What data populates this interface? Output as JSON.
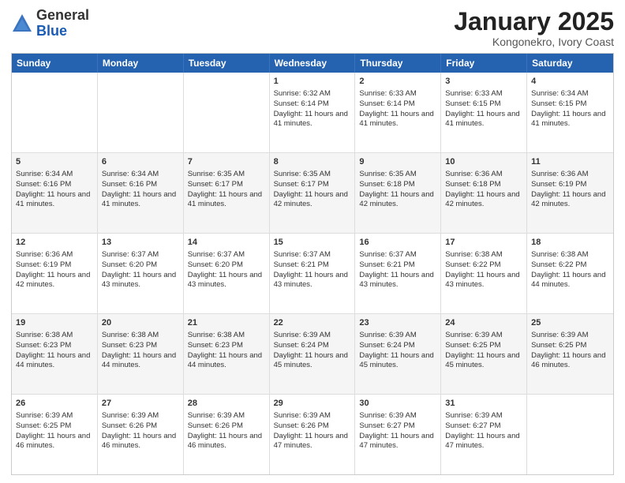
{
  "logo": {
    "general": "General",
    "blue": "Blue"
  },
  "title": "January 2025",
  "subtitle": "Kongonekro, Ivory Coast",
  "days": [
    "Sunday",
    "Monday",
    "Tuesday",
    "Wednesday",
    "Thursday",
    "Friday",
    "Saturday"
  ],
  "weeks": [
    [
      {
        "day": "",
        "info": "",
        "empty": true
      },
      {
        "day": "",
        "info": "",
        "empty": true
      },
      {
        "day": "",
        "info": "",
        "empty": true
      },
      {
        "day": "1",
        "info": "Sunrise: 6:32 AM\nSunset: 6:14 PM\nDaylight: 11 hours and 41 minutes.",
        "empty": false
      },
      {
        "day": "2",
        "info": "Sunrise: 6:33 AM\nSunset: 6:14 PM\nDaylight: 11 hours and 41 minutes.",
        "empty": false
      },
      {
        "day": "3",
        "info": "Sunrise: 6:33 AM\nSunset: 6:15 PM\nDaylight: 11 hours and 41 minutes.",
        "empty": false
      },
      {
        "day": "4",
        "info": "Sunrise: 6:34 AM\nSunset: 6:15 PM\nDaylight: 11 hours and 41 minutes.",
        "empty": false
      }
    ],
    [
      {
        "day": "5",
        "info": "Sunrise: 6:34 AM\nSunset: 6:16 PM\nDaylight: 11 hours and 41 minutes.",
        "empty": false
      },
      {
        "day": "6",
        "info": "Sunrise: 6:34 AM\nSunset: 6:16 PM\nDaylight: 11 hours and 41 minutes.",
        "empty": false
      },
      {
        "day": "7",
        "info": "Sunrise: 6:35 AM\nSunset: 6:17 PM\nDaylight: 11 hours and 41 minutes.",
        "empty": false
      },
      {
        "day": "8",
        "info": "Sunrise: 6:35 AM\nSunset: 6:17 PM\nDaylight: 11 hours and 42 minutes.",
        "empty": false
      },
      {
        "day": "9",
        "info": "Sunrise: 6:35 AM\nSunset: 6:18 PM\nDaylight: 11 hours and 42 minutes.",
        "empty": false
      },
      {
        "day": "10",
        "info": "Sunrise: 6:36 AM\nSunset: 6:18 PM\nDaylight: 11 hours and 42 minutes.",
        "empty": false
      },
      {
        "day": "11",
        "info": "Sunrise: 6:36 AM\nSunset: 6:19 PM\nDaylight: 11 hours and 42 minutes.",
        "empty": false
      }
    ],
    [
      {
        "day": "12",
        "info": "Sunrise: 6:36 AM\nSunset: 6:19 PM\nDaylight: 11 hours and 42 minutes.",
        "empty": false
      },
      {
        "day": "13",
        "info": "Sunrise: 6:37 AM\nSunset: 6:20 PM\nDaylight: 11 hours and 43 minutes.",
        "empty": false
      },
      {
        "day": "14",
        "info": "Sunrise: 6:37 AM\nSunset: 6:20 PM\nDaylight: 11 hours and 43 minutes.",
        "empty": false
      },
      {
        "day": "15",
        "info": "Sunrise: 6:37 AM\nSunset: 6:21 PM\nDaylight: 11 hours and 43 minutes.",
        "empty": false
      },
      {
        "day": "16",
        "info": "Sunrise: 6:37 AM\nSunset: 6:21 PM\nDaylight: 11 hours and 43 minutes.",
        "empty": false
      },
      {
        "day": "17",
        "info": "Sunrise: 6:38 AM\nSunset: 6:22 PM\nDaylight: 11 hours and 43 minutes.",
        "empty": false
      },
      {
        "day": "18",
        "info": "Sunrise: 6:38 AM\nSunset: 6:22 PM\nDaylight: 11 hours and 44 minutes.",
        "empty": false
      }
    ],
    [
      {
        "day": "19",
        "info": "Sunrise: 6:38 AM\nSunset: 6:23 PM\nDaylight: 11 hours and 44 minutes.",
        "empty": false
      },
      {
        "day": "20",
        "info": "Sunrise: 6:38 AM\nSunset: 6:23 PM\nDaylight: 11 hours and 44 minutes.",
        "empty": false
      },
      {
        "day": "21",
        "info": "Sunrise: 6:38 AM\nSunset: 6:23 PM\nDaylight: 11 hours and 44 minutes.",
        "empty": false
      },
      {
        "day": "22",
        "info": "Sunrise: 6:39 AM\nSunset: 6:24 PM\nDaylight: 11 hours and 45 minutes.",
        "empty": false
      },
      {
        "day": "23",
        "info": "Sunrise: 6:39 AM\nSunset: 6:24 PM\nDaylight: 11 hours and 45 minutes.",
        "empty": false
      },
      {
        "day": "24",
        "info": "Sunrise: 6:39 AM\nSunset: 6:25 PM\nDaylight: 11 hours and 45 minutes.",
        "empty": false
      },
      {
        "day": "25",
        "info": "Sunrise: 6:39 AM\nSunset: 6:25 PM\nDaylight: 11 hours and 46 minutes.",
        "empty": false
      }
    ],
    [
      {
        "day": "26",
        "info": "Sunrise: 6:39 AM\nSunset: 6:25 PM\nDaylight: 11 hours and 46 minutes.",
        "empty": false
      },
      {
        "day": "27",
        "info": "Sunrise: 6:39 AM\nSunset: 6:26 PM\nDaylight: 11 hours and 46 minutes.",
        "empty": false
      },
      {
        "day": "28",
        "info": "Sunrise: 6:39 AM\nSunset: 6:26 PM\nDaylight: 11 hours and 46 minutes.",
        "empty": false
      },
      {
        "day": "29",
        "info": "Sunrise: 6:39 AM\nSunset: 6:26 PM\nDaylight: 11 hours and 47 minutes.",
        "empty": false
      },
      {
        "day": "30",
        "info": "Sunrise: 6:39 AM\nSunset: 6:27 PM\nDaylight: 11 hours and 47 minutes.",
        "empty": false
      },
      {
        "day": "31",
        "info": "Sunrise: 6:39 AM\nSunset: 6:27 PM\nDaylight: 11 hours and 47 minutes.",
        "empty": false
      },
      {
        "day": "",
        "info": "",
        "empty": true
      }
    ]
  ]
}
